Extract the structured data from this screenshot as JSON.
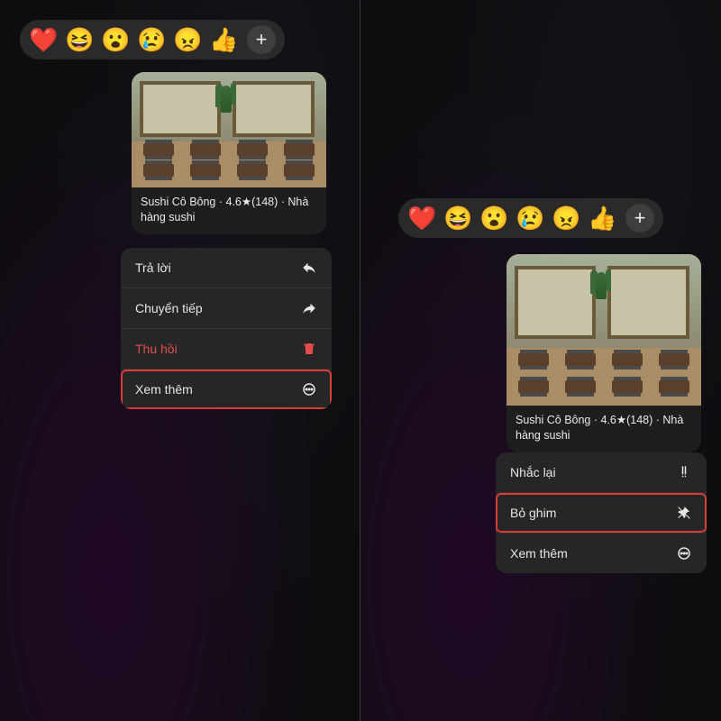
{
  "reactions": {
    "heart": "❤️",
    "laugh": "😆",
    "wow": "😮",
    "cry": "😢",
    "angry": "😠",
    "like": "👍",
    "plus": "+"
  },
  "card": {
    "caption": "Sushi Cô Bông · 4.6★(148) · Nhà hàng sushi"
  },
  "menu_left": {
    "reply": "Trả lời",
    "forward": "Chuyển tiếp",
    "recall": "Thu hồi",
    "more": "Xem thêm"
  },
  "menu_right": {
    "remind": "Nhắc lại",
    "unpin": "Bỏ ghim",
    "more": "Xem thêm"
  }
}
